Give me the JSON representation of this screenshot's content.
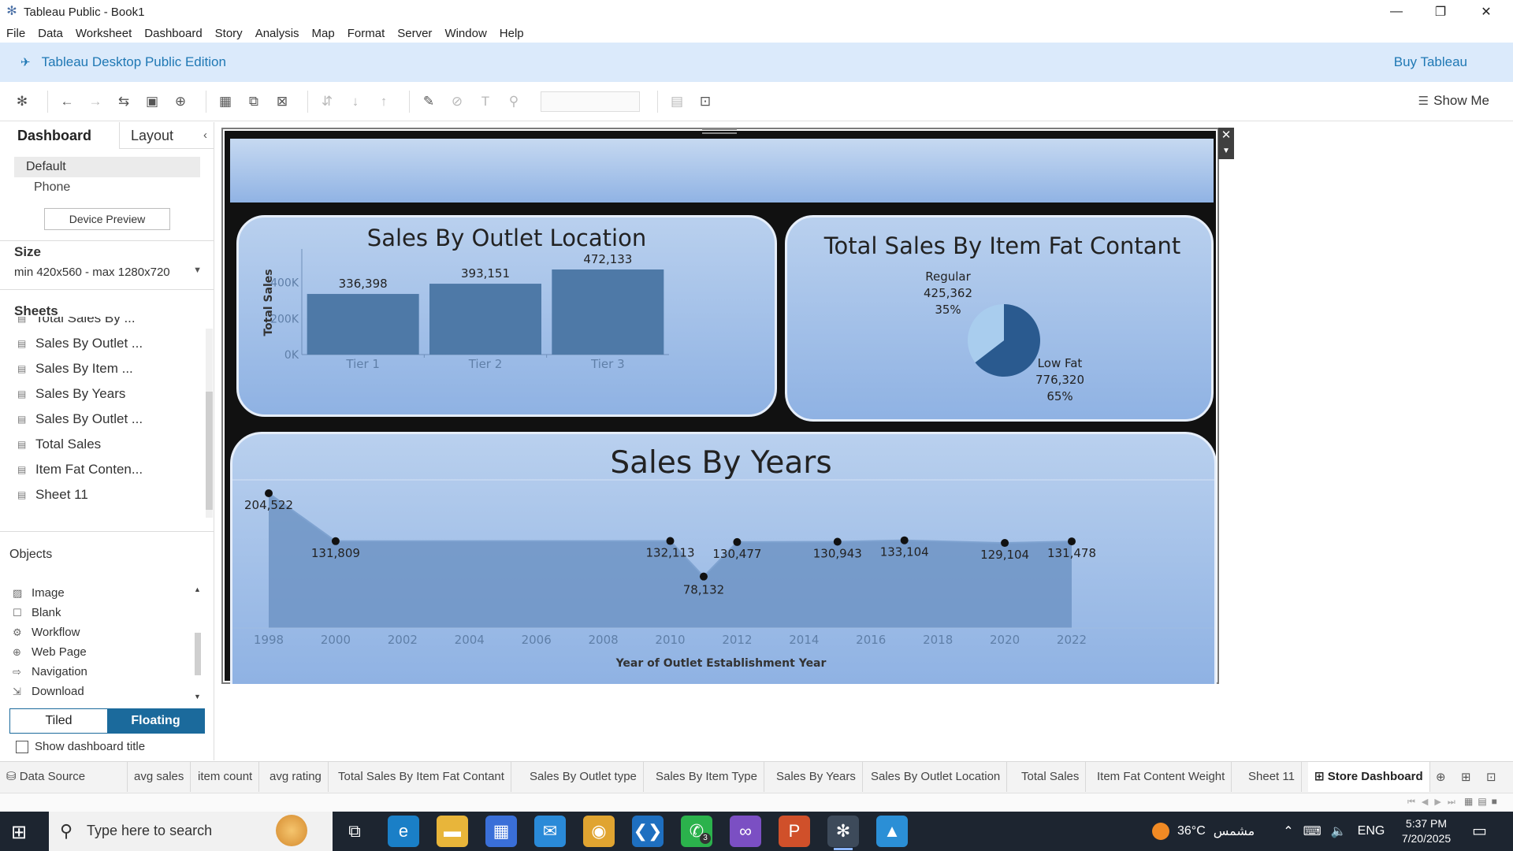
{
  "window": {
    "title": "Tableau Public - Book1",
    "controls": {
      "minimize": "—",
      "restore": "❐",
      "close": "✕"
    }
  },
  "menu": [
    "File",
    "Data",
    "Worksheet",
    "Dashboard",
    "Story",
    "Analysis",
    "Map",
    "Format",
    "Server",
    "Window",
    "Help"
  ],
  "banner": {
    "edition": "Tableau Desktop Public Edition",
    "buy": "Buy Tableau"
  },
  "toolbar": {
    "show_me": "Show Me"
  },
  "left_panel": {
    "tabs": {
      "dashboard": "Dashboard",
      "layout": "Layout"
    },
    "devices": {
      "default": "Default",
      "phone": "Phone",
      "preview_button": "Device Preview"
    },
    "size": {
      "heading": "Size",
      "value": "min 420x560 - max 1280x720"
    },
    "sheets": {
      "heading": "Sheets",
      "items": [
        "Total Sales By ...",
        "Sales By Outlet ...",
        "Sales By Item ...",
        "Sales By Years",
        "Sales By Outlet ...",
        "Total Sales",
        "Item Fat Conten...",
        "Sheet 11"
      ]
    },
    "objects": {
      "heading": "Objects",
      "items": [
        "Image",
        "Blank",
        "Workflow",
        "Web Page",
        "Navigation",
        "Download"
      ]
    },
    "layout_toggle": {
      "tiled": "Tiled",
      "floating": "Floating"
    },
    "show_title": "Show dashboard title"
  },
  "sheet_tabs": {
    "data_source": "Data Source",
    "tabs": [
      "avg sales",
      "item count",
      "avg rating",
      "Total Sales By Item Fat Contant",
      "Sales By Outlet type",
      "Sales By Item Type",
      "Sales By Years",
      "Sales By Outlet Location",
      "Total Sales",
      "Item Fat Content Weight",
      "Sheet 11",
      "Store Dashboard"
    ],
    "active": "Store Dashboard"
  },
  "taskbar": {
    "search_placeholder": "Type here to search",
    "whatsapp_count": "3",
    "weather": "36°C",
    "weather_desc": "مشمس",
    "lang": "ENG",
    "time": "5:37 PM",
    "date": "7/20/2025"
  },
  "colors": {
    "accent": "#1b6a9c",
    "bar": "#4e79a7",
    "pie_dark": "#2a5a8f",
    "pie_light": "#a9cdee",
    "panel_top": "#b9d0ee",
    "panel_bottom": "#8fb2e3"
  },
  "chart_data": [
    {
      "type": "bar",
      "title": "Sales By Outlet Location",
      "categories": [
        "Tier 1",
        "Tier 2",
        "Tier 3"
      ],
      "values": [
        336398,
        393151,
        472133
      ],
      "value_labels": [
        "336,398",
        "393,151",
        "472,133"
      ],
      "ylabel": "Total Sales",
      "ylim": [
        0,
        472133
      ],
      "yticks": [
        0,
        200000,
        400000
      ],
      "ytick_labels": [
        "0K",
        "200K",
        "400K"
      ],
      "grid": false
    },
    {
      "type": "pie",
      "title": "Total Sales By Item Fat Contant",
      "slices": [
        {
          "label": "Low Fat",
          "value": 776320,
          "value_label": "776,320",
          "percent": "65%"
        },
        {
          "label": "Regular",
          "value": 425362,
          "value_label": "425,362",
          "percent": "35%"
        }
      ]
    },
    {
      "type": "area",
      "title": "Sales By Years",
      "xlabel": "Year of Outlet Establishment Year",
      "x": [
        1998,
        2000,
        2010,
        2011,
        2012,
        2015,
        2017,
        2020,
        2022
      ],
      "values": [
        204522,
        131809,
        132113,
        78132,
        130477,
        130943,
        133104,
        129104,
        131478
      ],
      "value_labels": [
        "204,522",
        "131,809",
        "132,113",
        "78,132",
        "130,477",
        "130,943",
        "133,104",
        "129,104",
        "131,478"
      ],
      "xticks": [
        1998,
        2000,
        2002,
        2004,
        2006,
        2008,
        2010,
        2012,
        2014,
        2016,
        2018,
        2020,
        2022
      ],
      "xlim": [
        1998,
        2022
      ],
      "grid": false
    }
  ]
}
